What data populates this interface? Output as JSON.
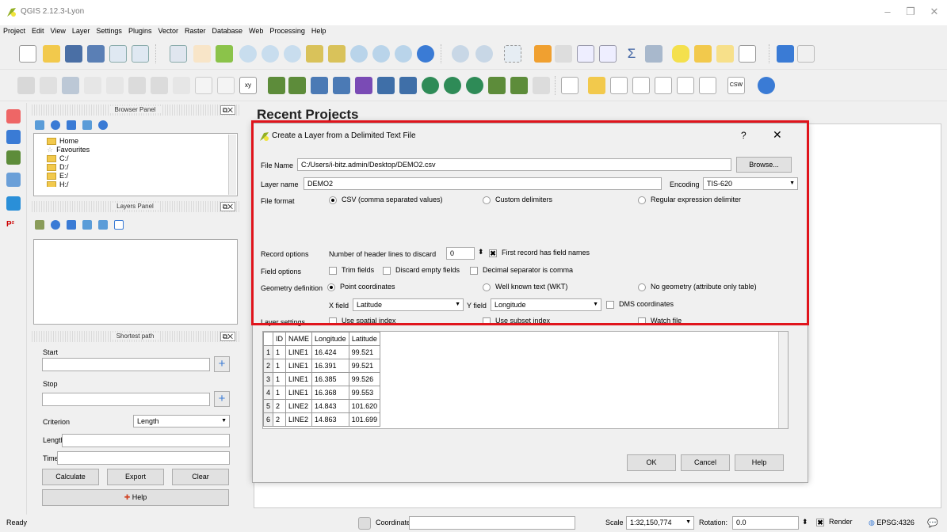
{
  "window": {
    "title": "QGIS 2.12.3-Lyon",
    "minimize": "–",
    "restore": "❐",
    "close": "✕"
  },
  "menu": [
    "Project",
    "Edit",
    "View",
    "Layer",
    "Settings",
    "Plugins",
    "Vector",
    "Raster",
    "Database",
    "Web",
    "Processing",
    "Help"
  ],
  "browser_panel": {
    "title": "Browser Panel",
    "items": [
      "Home",
      "Favourites",
      "C:/",
      "D:/",
      "E:/",
      "H:/"
    ]
  },
  "layers_panel": {
    "title": "Layers Panel"
  },
  "shortest_path": {
    "title": "Shortest path",
    "start_label": "Start",
    "stop_label": "Stop",
    "criterion_label": "Criterion",
    "criterion_value": "Length",
    "length_label": "Length",
    "time_label": "Time",
    "calculate": "Calculate",
    "export": "Export",
    "clear": "Clear",
    "help": "Help"
  },
  "main": {
    "recent_projects": "Recent Projects"
  },
  "dialog": {
    "title": "Create a Layer from a Delimited Text File",
    "help_q": "?",
    "close": "✕",
    "file_name_label": "File Name",
    "file_name_value": "C:/Users/i-bitz.admin/Desktop/DEMO2.csv",
    "browse": "Browse...",
    "layer_name_label": "Layer name",
    "layer_name_value": "DEMO2",
    "encoding_label": "Encoding",
    "encoding_value": "TIS-620",
    "file_format_label": "File format",
    "fmt_csv": "CSV (comma separated values)",
    "fmt_custom": "Custom delimiters",
    "fmt_regex": "Regular expression delimiter",
    "record_options_label": "Record options",
    "header_lines_label": "Number of header lines to discard",
    "header_lines_value": "0",
    "first_record": "First record has field names",
    "field_options_label": "Field options",
    "trim_fields": "Trim fields",
    "discard_empty": "Discard empty fields",
    "decimal_comma": "Decimal separator is comma",
    "geometry_label": "Geometry definition",
    "geom_point": "Point coordinates",
    "geom_wkt": "Well known text (WKT)",
    "geom_none": "No geometry (attribute only table)",
    "x_field_label": "X field",
    "x_field_value": "Latitude",
    "y_field_label": "Y field",
    "y_field_value": "Longitude",
    "dms": "DMS coordinates",
    "layer_settings_label": "Layer settings",
    "spatial_index": "Use spatial index",
    "subset_index": "Use subset index",
    "watch_file": "Watch file",
    "ok": "OK",
    "cancel": "Cancel",
    "help": "Help",
    "table": {
      "headers": [
        "ID",
        "NAME",
        "Longitude",
        "Latitude"
      ],
      "rows": [
        [
          "1",
          "1",
          "LINE1",
          "16.424",
          "99.521"
        ],
        [
          "2",
          "1",
          "LINE1",
          "16.391",
          "99.521"
        ],
        [
          "3",
          "1",
          "LINE1",
          "16.385",
          "99.526"
        ],
        [
          "4",
          "1",
          "LINE1",
          "16.368",
          "99.553"
        ],
        [
          "5",
          "2",
          "LINE2",
          "14.843",
          "101.620"
        ],
        [
          "6",
          "2",
          "LINE2",
          "14.863",
          "101.699"
        ]
      ]
    }
  },
  "status": {
    "ready": "Ready",
    "coordinate_label": "Coordinate:",
    "scale_label": "Scale",
    "scale_value": "1:32,150,774",
    "rotation_label": "Rotation:",
    "rotation_value": "0.0",
    "render": "Render",
    "crs": "EPSG:4326"
  },
  "colors": {
    "highlight": "#e0141c",
    "accent": "#3a7bd5"
  }
}
